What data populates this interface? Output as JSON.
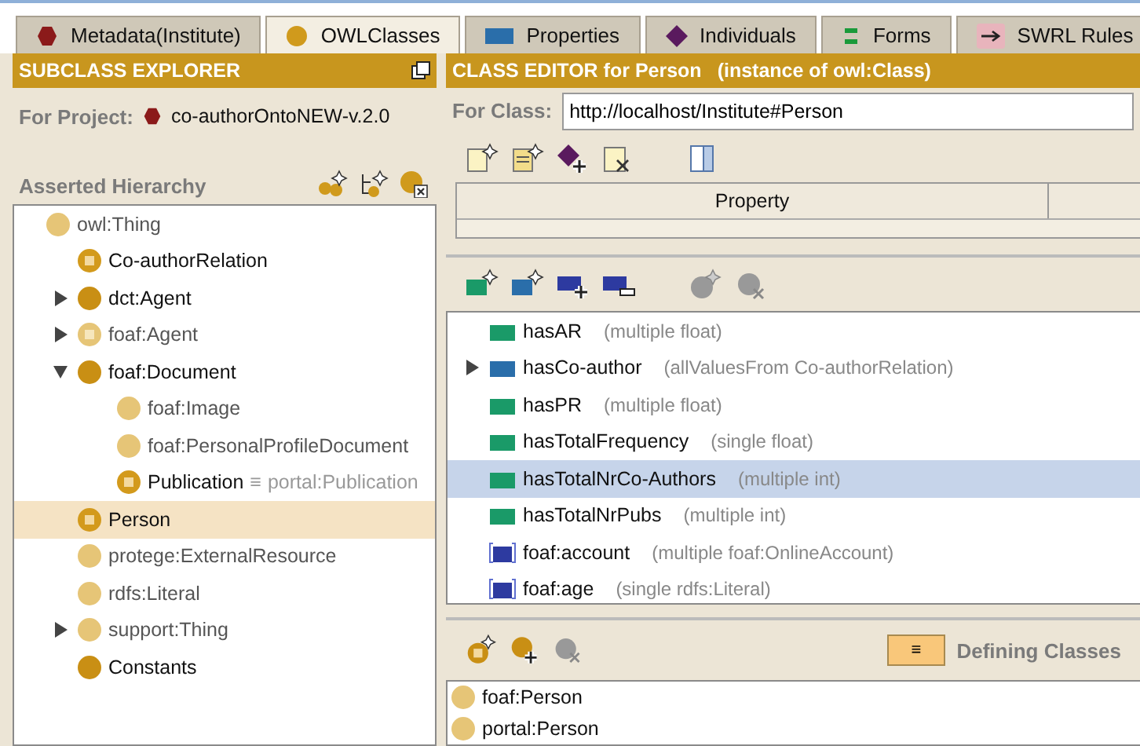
{
  "tabs": [
    {
      "label": "Metadata(Institute)",
      "kind": "metadata",
      "selected": false
    },
    {
      "label": "OWLClasses",
      "kind": "classes",
      "selected": true
    },
    {
      "label": "Properties",
      "kind": "properties",
      "selected": false
    },
    {
      "label": "Individuals",
      "kind": "individuals",
      "selected": false
    },
    {
      "label": "Forms",
      "kind": "forms",
      "selected": false
    },
    {
      "label": "SWRL Rules",
      "kind": "swrl",
      "selected": false
    }
  ],
  "subclass_explorer": {
    "title": "SUBCLASS EXPLORER",
    "project_label": "For Project:",
    "project": "co-authorOntoNEW-v.2.0",
    "hierarchy_label": "Asserted Hierarchy",
    "tree": [
      {
        "label": "owl:Thing",
        "kind": "imported",
        "selected": false,
        "children": [
          {
            "label": "Co-authorRelation",
            "kind": "defined",
            "selected": false
          },
          {
            "label": "dct:Agent",
            "kind": "primitive",
            "selected": false,
            "expanded": false
          },
          {
            "label": "foaf:Agent",
            "kind": "imported-defined",
            "selected": false,
            "expanded": false
          },
          {
            "label": "foaf:Document",
            "kind": "primitive",
            "selected": false,
            "expanded": true,
            "children": [
              {
                "label": "foaf:Image",
                "kind": "imported",
                "selected": false
              },
              {
                "label": "foaf:PersonalProfileDocument",
                "kind": "imported",
                "selected": false
              },
              {
                "label": "Publication",
                "kind": "defined",
                "selected": false,
                "equivalent_mark": "≡",
                "equivalent": "portal:Publication"
              }
            ]
          },
          {
            "label": "Person",
            "kind": "defined",
            "selected": true
          },
          {
            "label": "protege:ExternalResource",
            "kind": "imported",
            "selected": false
          },
          {
            "label": "rdfs:Literal",
            "kind": "imported",
            "selected": false
          },
          {
            "label": "support:Thing",
            "kind": "imported",
            "selected": false,
            "expanded": false
          },
          {
            "label": "Constants",
            "kind": "primitive",
            "selected": false
          }
        ]
      }
    ]
  },
  "class_editor": {
    "title": "CLASS EDITOR for Person",
    "subtitle": "(instance of owl:Class)",
    "class_label": "For Class:",
    "class_uri": "http://localhost/Institute#Person",
    "table": {
      "columns": [
        "Property"
      ]
    },
    "properties": [
      {
        "name": "hasAR",
        "kind": "datatype",
        "detail": "(multiple float)",
        "selected": false
      },
      {
        "name": "hasCo-author",
        "kind": "object",
        "detail": "(allValuesFrom Co-authorRelation)",
        "selected": false,
        "expanded": false
      },
      {
        "name": "hasPR",
        "kind": "datatype",
        "detail": "(multiple float)",
        "selected": false
      },
      {
        "name": "hasTotalFrequency",
        "kind": "datatype",
        "detail": "(single float)",
        "selected": false
      },
      {
        "name": "hasTotalNrCo-Authors",
        "kind": "datatype",
        "detail": "(multiple int)",
        "selected": true
      },
      {
        "name": "hasTotalNrPubs",
        "kind": "datatype",
        "detail": "(multiple int)",
        "selected": false
      },
      {
        "name": "foaf:account",
        "kind": "imported",
        "detail": "(multiple foaf:OnlineAccount)",
        "selected": false
      },
      {
        "name": "foaf:age",
        "kind": "imported",
        "detail": "(single rdfs:Literal)",
        "selected": false
      }
    ],
    "defining_button": "≡",
    "defining_label": "Defining Classes",
    "defining_classes": [
      {
        "label": "foaf:Person"
      },
      {
        "label": "portal:Person"
      }
    ]
  }
}
